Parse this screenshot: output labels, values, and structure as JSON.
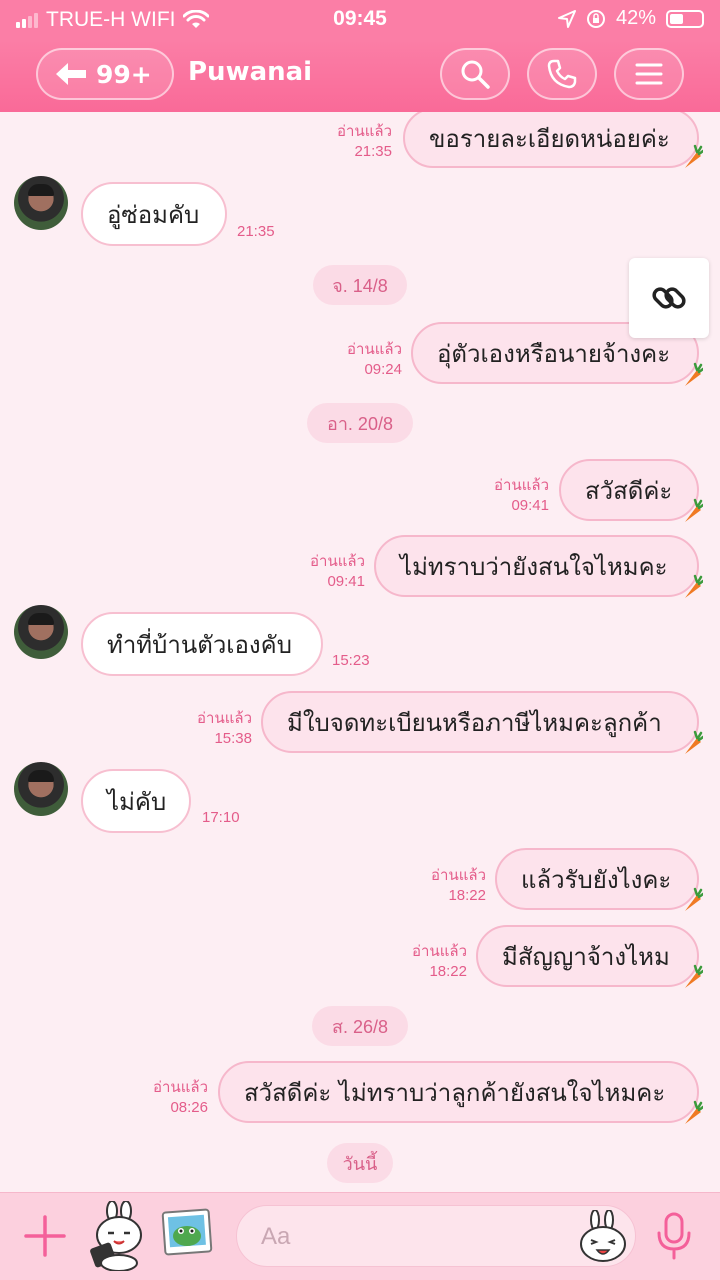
{
  "status_bar": {
    "carrier": "TRUE-H WIFI",
    "time": "09:45",
    "battery_percent": "42%",
    "battery_level": 0.42
  },
  "header": {
    "back_count": "99+",
    "title": "Puwanai",
    "icons": [
      "back-arrow-icon",
      "search-icon",
      "phone-icon",
      "menu-icon"
    ]
  },
  "colors": {
    "header": "#fb7ea6",
    "background": "#fdeef3",
    "bubble_out": "#fde3ec",
    "bubble_in": "#ffffff",
    "accent": "#e45c8a"
  },
  "messages": [
    {
      "type": "out",
      "text": "ขอรายละเอียดหน่อยค่ะ",
      "read": "อ่านแล้ว",
      "time": "21:35"
    },
    {
      "type": "in",
      "text": "อู่ซ่อมคับ",
      "time": "21:35"
    },
    {
      "type": "date",
      "text": "จ. 14/8"
    },
    {
      "type": "out",
      "text": "อุ่ตัวเองหรือนายจ้างคะ",
      "read": "อ่านแล้ว",
      "time": "09:24"
    },
    {
      "type": "date",
      "text": "อา. 20/8"
    },
    {
      "type": "out",
      "text": "สวัสดีค่ะ",
      "read": "อ่านแล้ว",
      "time": "09:41"
    },
    {
      "type": "out",
      "text": "ไม่ทราบว่ายังสนใจไหมคะ",
      "read": "อ่านแล้ว",
      "time": "09:41"
    },
    {
      "type": "in",
      "text": "ทำที่บ้านตัวเองคับ",
      "time": "15:23"
    },
    {
      "type": "out",
      "text": "มีใบจดทะเบียนหรือภาษีไหมคะลูกค้า",
      "read": "อ่านแล้ว",
      "time": "15:38"
    },
    {
      "type": "in",
      "text": "ไม่คับ",
      "time": "17:10"
    },
    {
      "type": "out",
      "text": "แล้วรับยังไงคะ",
      "read": "อ่านแล้ว",
      "time": "18:22"
    },
    {
      "type": "out",
      "text": "มีสัญญาจ้างไหม",
      "read": "อ่านแล้ว",
      "time": "18:22"
    },
    {
      "type": "date",
      "text": "ส. 26/8"
    },
    {
      "type": "out",
      "text": "สวัสดีค่ะ ไม่ทราบว่าลูกค้ายังสนใจไหมคะ",
      "read": "อ่านแล้ว",
      "time": "08:26"
    },
    {
      "type": "date",
      "text": "วันนี้"
    }
  ],
  "input": {
    "placeholder": "Aa"
  },
  "bottom_icons": [
    "plus-icon",
    "sticker-icon",
    "photo-icon",
    "emoji-icon",
    "microphone-icon"
  ]
}
